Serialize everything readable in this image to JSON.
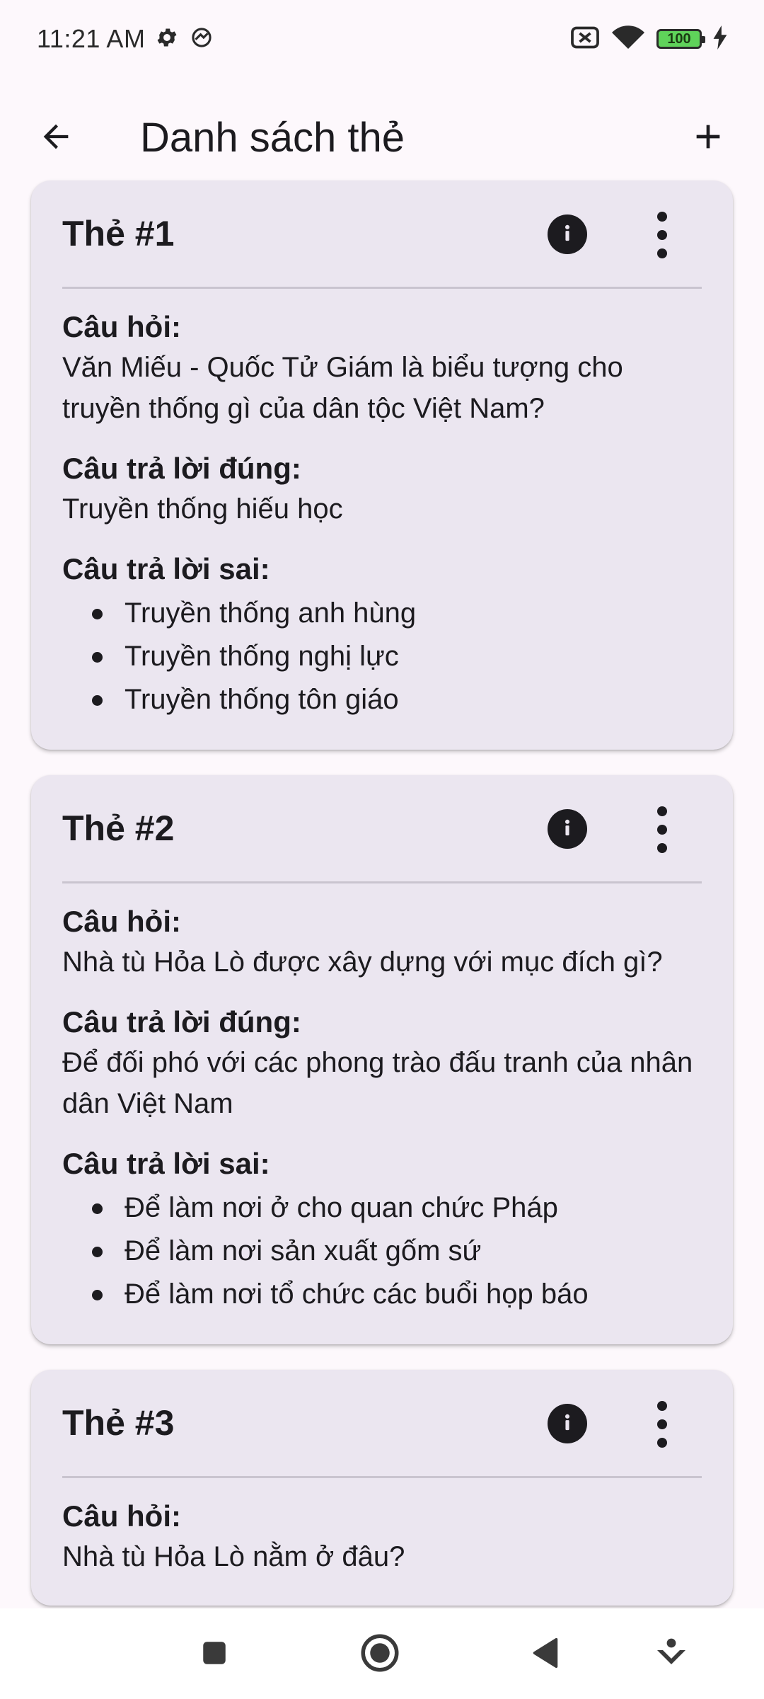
{
  "status_bar": {
    "time": "11:21 AM",
    "battery_level": "100",
    "icons": [
      "settings-icon",
      "vpn-icon",
      "no-sim-icon",
      "wifi-icon",
      "battery-icon",
      "charging-icon"
    ]
  },
  "app_bar": {
    "title": "Danh sách thẻ",
    "back_icon": "arrow-back-icon",
    "add_icon": "plus-icon"
  },
  "labels": {
    "question": "Câu hỏi:",
    "correct_answer": "Câu trả lời đúng:",
    "wrong_answers": "Câu trả lời sai:"
  },
  "cards": [
    {
      "title": "Thẻ #1",
      "question": "Văn Miếu - Quốc Tử Giám là biểu tượng cho truyền thống gì của dân tộc Việt Nam?",
      "correct": "Truyền thống hiếu học",
      "wrong": [
        "Truyền thống anh hùng",
        "Truyền thống nghị lực",
        "Truyền thống tôn giáo"
      ]
    },
    {
      "title": "Thẻ #2",
      "question": "Nhà tù Hỏa Lò được xây dựng với mục đích gì?",
      "correct": "Để đối phó với các phong trào đấu tranh của nhân dân Việt Nam",
      "wrong": [
        "Để làm nơi ở cho quan chức Pháp",
        "Để làm nơi sản xuất gốm sứ",
        "Để làm nơi tổ chức các buổi họp báo"
      ]
    },
    {
      "title": "Thẻ #3",
      "question": "Nhà tù Hỏa Lò nằm ở đâu?"
    }
  ],
  "nav_bar": {
    "icons": [
      "square-icon",
      "home-circle-icon",
      "back-triangle-icon",
      "assistant-icon"
    ]
  },
  "colors": {
    "background": "#fdf8fc",
    "card": "#ebe6f0",
    "text": "#1c1b1f",
    "divider": "#c9c4cf",
    "battery": "#5fd35a"
  }
}
